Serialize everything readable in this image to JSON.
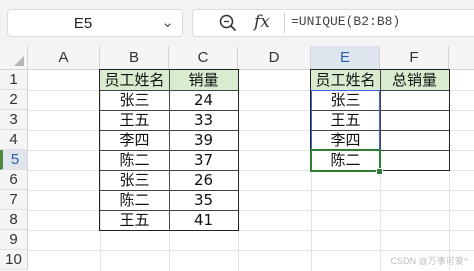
{
  "name_box": {
    "value": "E5"
  },
  "formula_bar": {
    "formula": "=UNIQUE(B2:B8)"
  },
  "columns": [
    "A",
    "B",
    "C",
    "D",
    "E",
    "F"
  ],
  "rows": [
    "1",
    "2",
    "3",
    "4",
    "5",
    "6",
    "7",
    "8",
    "9",
    "10"
  ],
  "selected_column": "E",
  "selected_row": "5",
  "source_table": {
    "headers": [
      "员工姓名",
      "销量"
    ],
    "rows": [
      [
        "张三",
        "24"
      ],
      [
        "王五",
        "33"
      ],
      [
        "李四",
        "39"
      ],
      [
        "陈二",
        "37"
      ],
      [
        "张三",
        "26"
      ],
      [
        "陈二",
        "35"
      ],
      [
        "王五",
        "41"
      ]
    ]
  },
  "result_table": {
    "headers": [
      "员工姓名",
      "总销量"
    ],
    "names": [
      "张三",
      "王五",
      "李四",
      "陈二"
    ]
  },
  "watermark": "CSDN @万事可爱^",
  "colors": {
    "header_fill": "#d9ecd0",
    "selection_green": "#2e7d32",
    "spill_border": "#3c6ad8"
  }
}
